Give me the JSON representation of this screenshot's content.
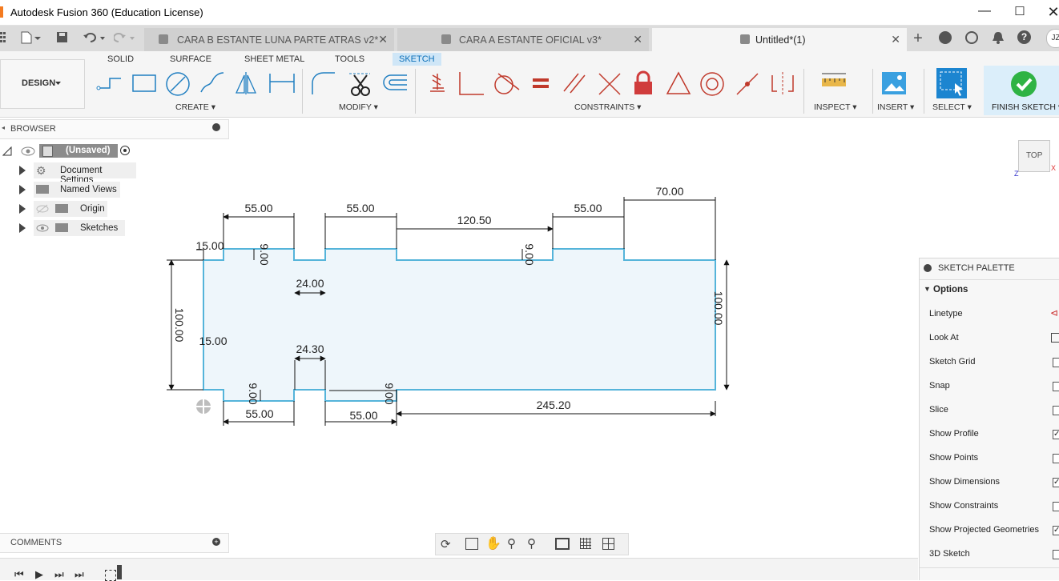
{
  "app": {
    "title": "Autodesk Fusion 360 (Education License)"
  },
  "tabs": [
    {
      "label": "CARA  B ESTANTE LUNA PARTE ATRAS v2*"
    },
    {
      "label": "CARA A ESTANTE OFICIAL v3*"
    },
    {
      "label": "Untitled*(1)"
    }
  ],
  "user_initials": "JZ",
  "workspace": {
    "label": "DESIGN"
  },
  "menu_tabs": [
    "SOLID",
    "SURFACE",
    "SHEET METAL",
    "TOOLS",
    "SKETCH"
  ],
  "groups": {
    "create": "CREATE",
    "modify": "MODIFY",
    "constraints": "CONSTRAINTS",
    "inspect": "INSPECT",
    "insert": "INSERT",
    "select": "SELECT",
    "finish": "FINISH SKETCH"
  },
  "browser": {
    "title": "BROWSER",
    "root": "(Unsaved)",
    "items": [
      "Document Settings",
      "Named Views",
      "Origin",
      "Sketches"
    ]
  },
  "comments": {
    "title": "COMMENTS"
  },
  "viewcube": {
    "label": "TOP",
    "axis_x": "X",
    "axis_z": "Z"
  },
  "dimensions": {
    "d1": "55.00",
    "d2": "55.00",
    "d3": "120.50",
    "d4": "55.00",
    "d5": "70.00",
    "d6": "15.00",
    "d7": "9.00",
    "d8": "9.00",
    "d9": "24.00",
    "d10": "100.00",
    "d11": "100.00",
    "d12": "15.00",
    "d13": "24.30",
    "d14": "9.00",
    "d15": "9.00",
    "d16": "55.00",
    "d17": "55.00",
    "d18": "245.20"
  },
  "palette": {
    "title": "SKETCH PALETTE",
    "section": "Options",
    "rows": [
      {
        "label": "Linetype"
      },
      {
        "label": "Look At"
      },
      {
        "label": "Sketch Grid",
        "checked": false
      },
      {
        "label": "Snap",
        "checked": false
      },
      {
        "label": "Slice",
        "checked": false
      },
      {
        "label": "Show Profile",
        "checked": true
      },
      {
        "label": "Show Points",
        "checked": false
      },
      {
        "label": "Show Dimensions",
        "checked": true
      },
      {
        "label": "Show Constraints",
        "checked": false
      },
      {
        "label": "Show Projected Geometries",
        "checked": true
      },
      {
        "label": "3D Sketch",
        "checked": false
      }
    ]
  },
  "colors": {
    "accent": "#0696d7",
    "profile_fill": "#eef6fb",
    "sketch_line": "#4fb3d9",
    "finish_green": "#2fb344"
  }
}
